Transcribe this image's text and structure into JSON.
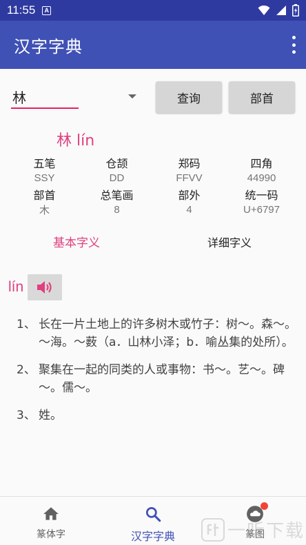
{
  "status_bar": {
    "time": "11:55",
    "badge": "A"
  },
  "app_bar": {
    "title": "汉字字典"
  },
  "search": {
    "value": "林",
    "query_label": "查询",
    "radical_label": "部首"
  },
  "heading": "林 lín",
  "info_table": {
    "row1_labels": [
      "五笔",
      "仓颉",
      "郑码",
      "四角"
    ],
    "row1_values": [
      "SSY",
      "DD",
      "FFVV",
      "44990"
    ],
    "row2_labels": [
      "部首",
      "总笔画",
      "部外",
      "统一码"
    ],
    "row2_values": [
      "木",
      "8",
      "4",
      "U+6797"
    ]
  },
  "tabs": {
    "basic": "基本字义",
    "detail": "详细字义"
  },
  "pinyin": "lín",
  "definitions": [
    {
      "num": "1、",
      "text": "长在一片土地上的许多树木或竹子：树～。森～。～海。～薮（a．山林小泽；b．喻丛集的处所）。"
    },
    {
      "num": "2、",
      "text": "聚集在一起的同类的人或事物：书～。艺～。碑～。儒～。"
    },
    {
      "num": "3、",
      "text": "姓。"
    }
  ],
  "bottom_nav": {
    "item1": "篆体字",
    "item2": "汉字字典",
    "item3": "篆图"
  },
  "watermark": "一听下载",
  "colors": {
    "primary": "#3f51b5",
    "status": "#2e3aa0",
    "accent": "#e0407f"
  }
}
